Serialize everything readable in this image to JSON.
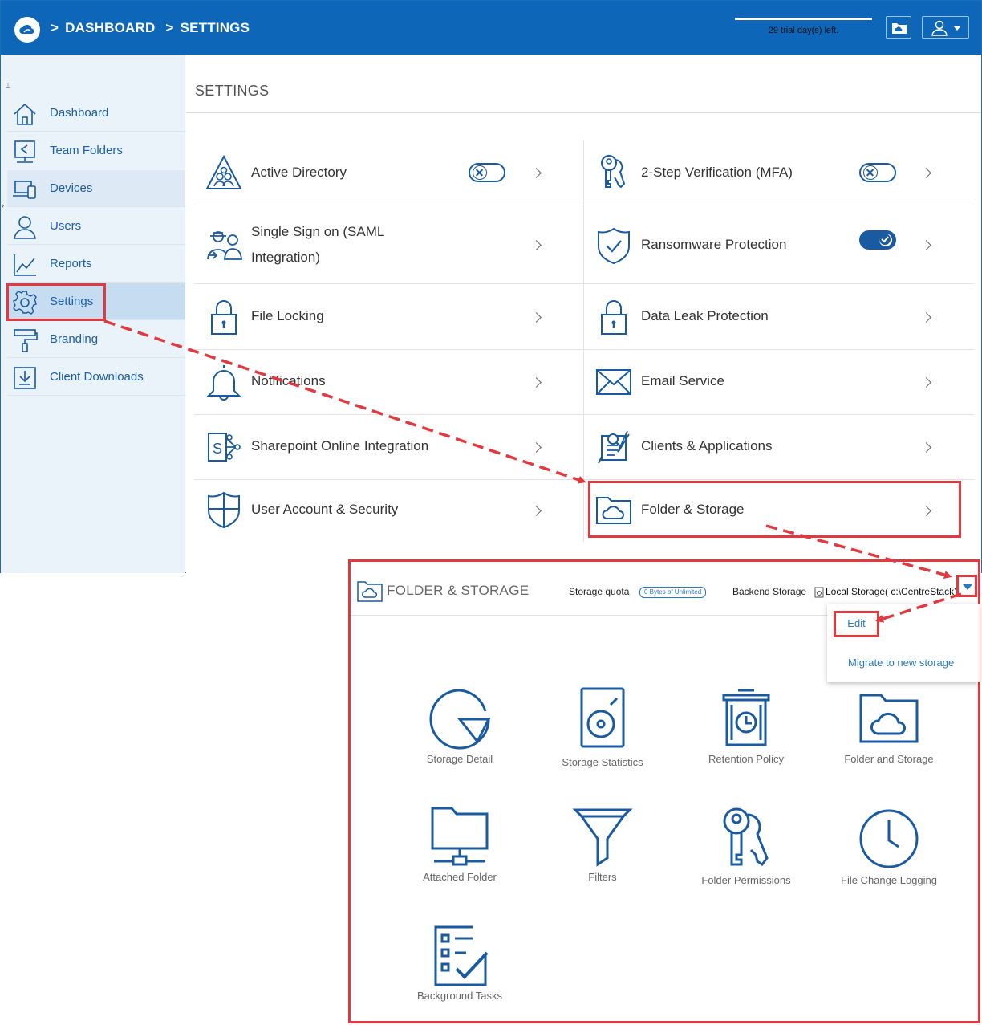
{
  "header": {
    "breadcrumb": [
      ">",
      "DASHBOARD",
      ">",
      "SETTINGS"
    ],
    "trial_text": "29 trial day(s) left."
  },
  "sidebar": {
    "collapse_glyph": "⌶",
    "items": [
      {
        "label": "Dashboard",
        "icon": "home-icon"
      },
      {
        "label": "Team Folders",
        "icon": "team-folder-icon"
      },
      {
        "label": "Devices",
        "icon": "devices-icon"
      },
      {
        "label": "Users",
        "icon": "user-icon"
      },
      {
        "label": "Reports",
        "icon": "reports-icon"
      },
      {
        "label": "Settings",
        "icon": "gear-icon"
      },
      {
        "label": "Branding",
        "icon": "paint-roller-icon"
      },
      {
        "label": "Client Downloads",
        "icon": "download-icon"
      }
    ]
  },
  "settings": {
    "title": "SETTINGS",
    "left": [
      {
        "label": "Active Directory",
        "icon": "active-directory-icon",
        "toggle": "off"
      },
      {
        "label": "Single Sign on (SAML Integration)",
        "icon": "sso-icon"
      },
      {
        "label": "File Locking",
        "icon": "lock-icon"
      },
      {
        "label": "Notifications",
        "icon": "bell-icon"
      },
      {
        "label": "Sharepoint Online Integration",
        "icon": "sharepoint-icon"
      },
      {
        "label": "User Account & Security",
        "icon": "shield-icon"
      }
    ],
    "right": [
      {
        "label": "2-Step Verification (MFA)",
        "icon": "keys-icon",
        "toggle": "off"
      },
      {
        "label": "Ransomware Protection",
        "icon": "shield-check-icon",
        "toggle": "on"
      },
      {
        "label": "Data Leak Protection",
        "icon": "lock-icon"
      },
      {
        "label": "Email Service",
        "icon": "envelope-icon"
      },
      {
        "label": "Clients & Applications",
        "icon": "clients-apps-icon"
      },
      {
        "label": "Folder & Storage",
        "icon": "cloud-folder-icon"
      }
    ]
  },
  "folder_storage": {
    "title": "FOLDER & STORAGE",
    "storage_quota_label": "Storage quota",
    "storage_quota_value": "0 Bytes of Unlimited",
    "backend_label": "Backend Storage",
    "backend_value": "Local Storage( c:\\CentreStack)",
    "menu": {
      "edit": "Edit",
      "migrate": "Migrate to new storage"
    },
    "tiles": [
      {
        "label": "Storage Detail",
        "icon": "pie-chart-icon"
      },
      {
        "label": "Storage Statistics",
        "icon": "hard-disk-icon"
      },
      {
        "label": "Retention Policy",
        "icon": "trash-clock-icon"
      },
      {
        "label": "Folder and Storage",
        "icon": "cloud-folder-icon"
      },
      {
        "label": "Attached Folder",
        "icon": "network-folder-icon"
      },
      {
        "label": "Filters",
        "icon": "funnel-icon"
      },
      {
        "label": "Folder Permissions",
        "icon": "keys-icon"
      },
      {
        "label": "File Change Logging",
        "icon": "clock-icon"
      },
      {
        "label": "Background Tasks",
        "icon": "checklist-icon"
      }
    ]
  },
  "colors": {
    "header_blue": "#0d66b7",
    "icon_blue": "#1a5aa0",
    "annotation_red": "#e2383f"
  }
}
